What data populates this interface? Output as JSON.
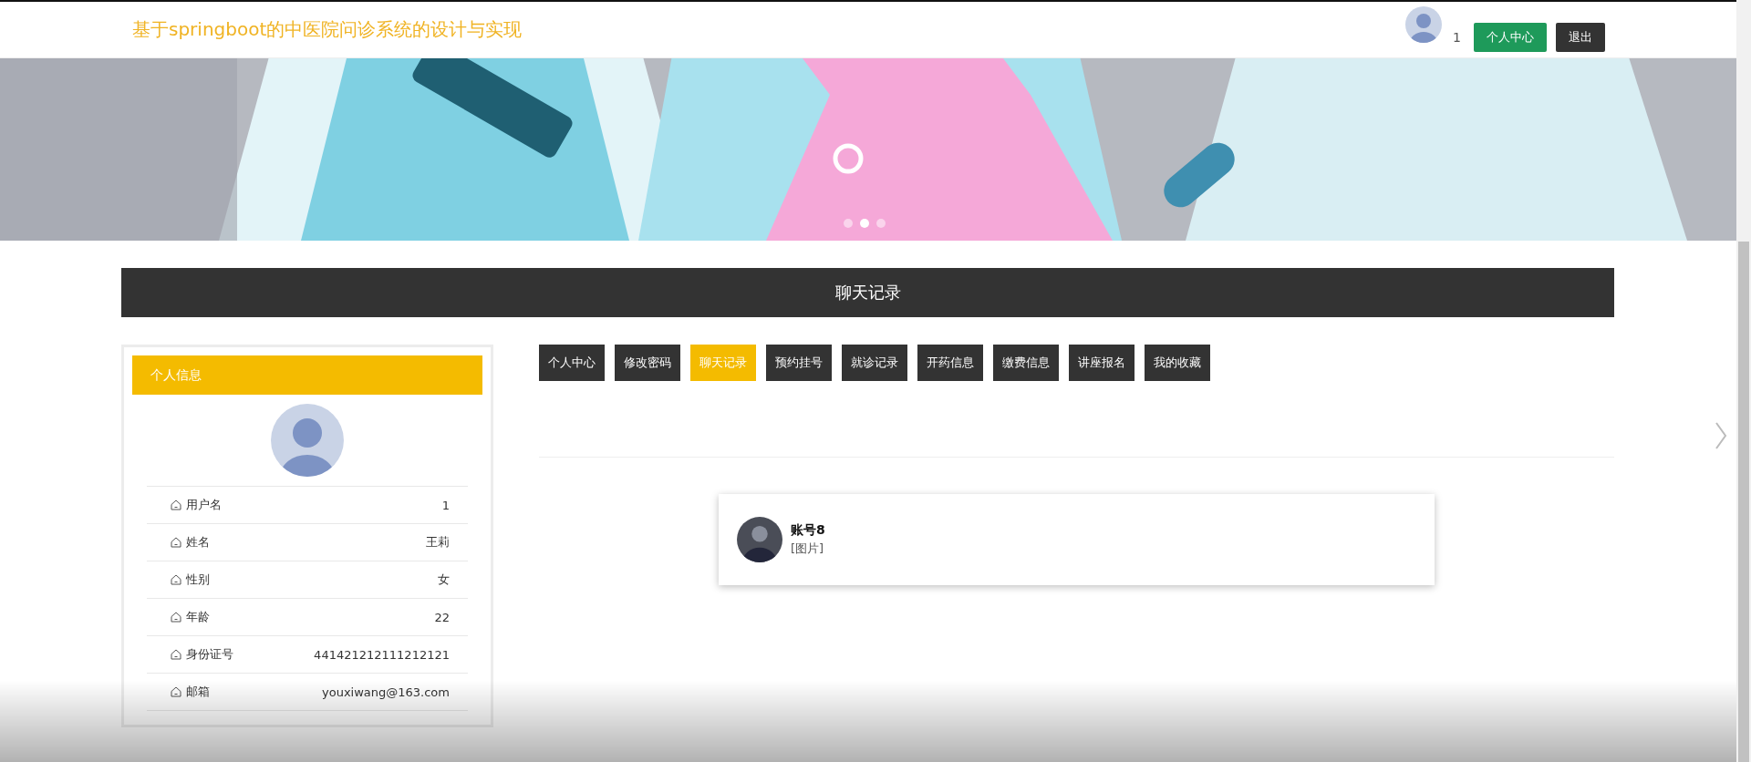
{
  "header": {
    "title": "基于springboot的中医院问诊系统的设计与实现",
    "user": "1",
    "buttons": [
      {
        "label": "个人中心",
        "kind": "primary"
      },
      {
        "label": "退出",
        "kind": "dark"
      }
    ]
  },
  "banner": {
    "kind": "picture",
    "dots": [
      {
        "selected": false
      },
      {
        "selected": true
      },
      {
        "selected": false
      }
    ]
  },
  "section_title": "聊天记录",
  "profile": {
    "heading": "个人信息",
    "fields": [
      {
        "label": "用户名",
        "value": "1"
      },
      {
        "label": "姓名",
        "value": "王莉"
      },
      {
        "label": "性别",
        "value": "女"
      },
      {
        "label": "年龄",
        "value": "22"
      },
      {
        "label": "身份证号",
        "value": "441421212111212121"
      },
      {
        "label": "邮箱",
        "value": "youxiwang@163.com"
      }
    ]
  },
  "tabs": [
    {
      "label": "个人中心",
      "selected": false
    },
    {
      "label": "修改密码",
      "selected": false
    },
    {
      "label": "聊天记录",
      "selected": true
    },
    {
      "label": "预约挂号",
      "selected": false
    },
    {
      "label": "就诊记录",
      "selected": false
    },
    {
      "label": "开药信息",
      "selected": false
    },
    {
      "label": "缴费信息",
      "selected": false
    },
    {
      "label": "讲座报名",
      "selected": false
    },
    {
      "label": "我的收藏",
      "selected": false
    }
  ],
  "chats": [
    {
      "name": "账号8",
      "message": "[图片]"
    }
  ]
}
